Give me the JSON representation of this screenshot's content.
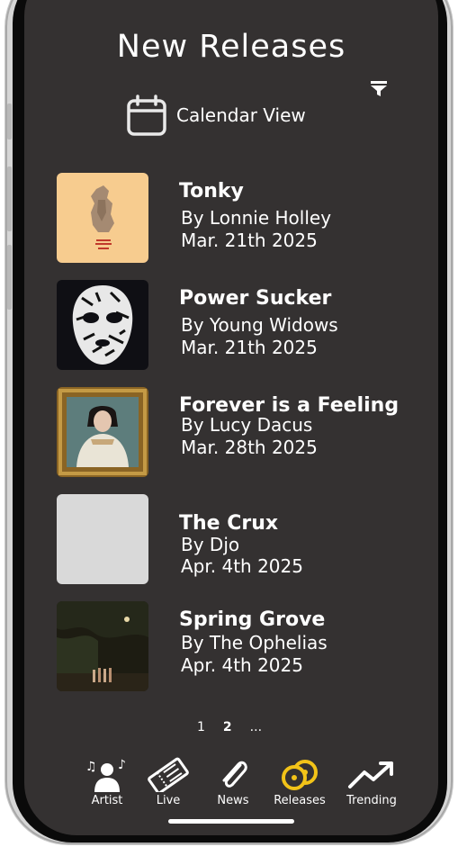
{
  "header": {
    "title": "New Releases",
    "filter_icon": "filter-icon"
  },
  "calendar": {
    "label": "Calendar View",
    "icon": "calendar-icon"
  },
  "releases": [
    {
      "title": "Tonky",
      "artist": "By Lonnie Holley",
      "date": "Mar. 21th 2025",
      "cover_color": "#f7cc8f"
    },
    {
      "title": "Power Sucker",
      "artist": "By Young Widows",
      "date": "Mar. 21th 2025",
      "cover_color": "#0f0f14"
    },
    {
      "title": "Forever is a Feeling",
      "artist": "By Lucy Dacus",
      "date": "Mar. 28th 2025",
      "cover_color": "#8a6424"
    },
    {
      "title": "The Crux",
      "artist": "By Djo",
      "date": "Apr. 4th 2025",
      "cover_color": "#d9d9d9"
    },
    {
      "title": "Spring Grove",
      "artist": "By The Ophelias",
      "date": "Apr. 4th 2025",
      "cover_color": "#1d1c12"
    }
  ],
  "pagination": {
    "pages": [
      "1",
      "2",
      "..."
    ],
    "current": "2"
  },
  "tabbar": {
    "items": [
      {
        "label": "Artist",
        "icon": "artist-icon",
        "active": false
      },
      {
        "label": "Live",
        "icon": "ticket-icon",
        "active": false
      },
      {
        "label": "News",
        "icon": "paperclip-icon",
        "active": false
      },
      {
        "label": "Releases",
        "icon": "vinyl-icon",
        "active": true
      },
      {
        "label": "Trending",
        "icon": "trending-icon",
        "active": false
      }
    ],
    "active_color": "#f2c318",
    "inactive_color": "#ffffff"
  }
}
